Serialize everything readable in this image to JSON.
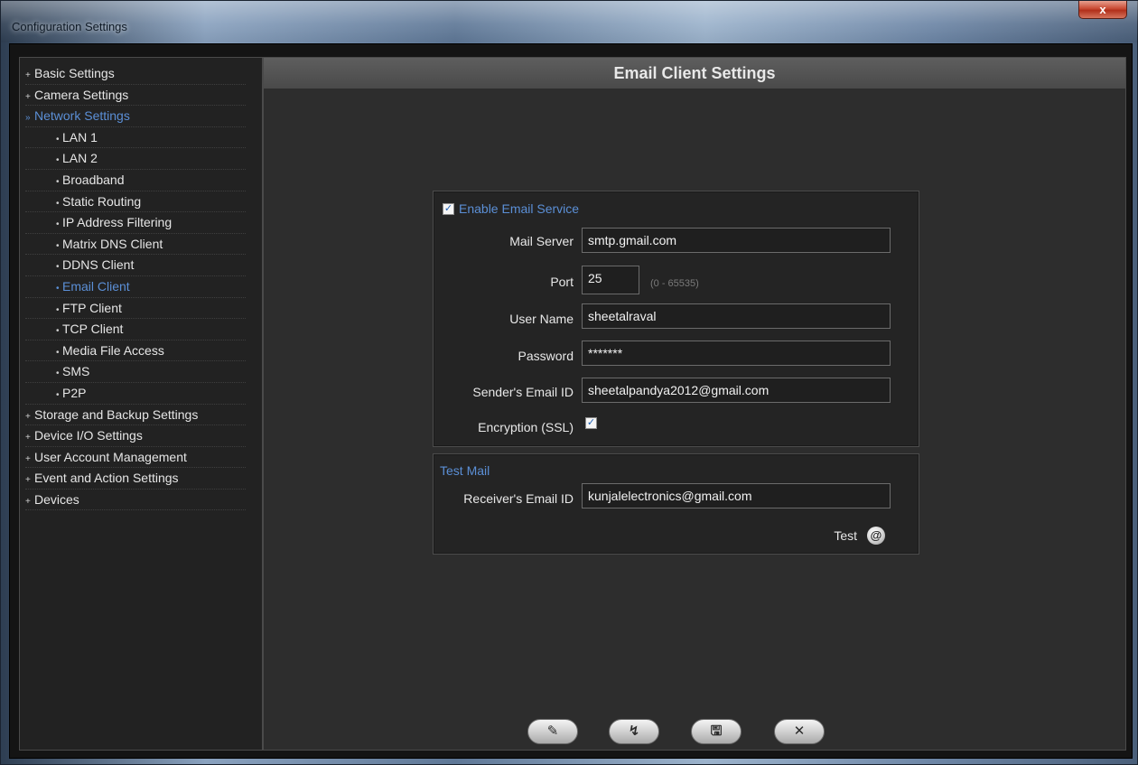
{
  "window": {
    "title": "Configuration Settings",
    "close_glyph": "x"
  },
  "sidebar": {
    "items": [
      {
        "label": "Basic Settings",
        "mark": "+",
        "level": 0,
        "active": false
      },
      {
        "label": "Camera Settings",
        "mark": "+",
        "level": 0,
        "active": false
      },
      {
        "label": "Network Settings",
        "mark": "»",
        "level": 0,
        "active": true
      },
      {
        "label": "LAN 1",
        "mark": "•",
        "level": 1,
        "active": false
      },
      {
        "label": "LAN 2",
        "mark": "•",
        "level": 1,
        "active": false
      },
      {
        "label": "Broadband",
        "mark": "•",
        "level": 1,
        "active": false
      },
      {
        "label": "Static Routing",
        "mark": "•",
        "level": 1,
        "active": false
      },
      {
        "label": "IP Address Filtering",
        "mark": "•",
        "level": 1,
        "active": false
      },
      {
        "label": "Matrix DNS Client",
        "mark": "•",
        "level": 1,
        "active": false
      },
      {
        "label": "DDNS Client",
        "mark": "•",
        "level": 1,
        "active": false
      },
      {
        "label": "Email Client",
        "mark": "•",
        "level": 1,
        "active": true
      },
      {
        "label": "FTP Client",
        "mark": "•",
        "level": 1,
        "active": false
      },
      {
        "label": "TCP Client",
        "mark": "•",
        "level": 1,
        "active": false
      },
      {
        "label": "Media File Access",
        "mark": "•",
        "level": 1,
        "active": false
      },
      {
        "label": "SMS",
        "mark": "•",
        "level": 1,
        "active": false
      },
      {
        "label": "P2P",
        "mark": "•",
        "level": 1,
        "active": false
      },
      {
        "label": "Storage and Backup Settings",
        "mark": "+",
        "level": 0,
        "active": false
      },
      {
        "label": "Device I/O Settings",
        "mark": "+",
        "level": 0,
        "active": false
      },
      {
        "label": "User Account Management",
        "mark": "+",
        "level": 0,
        "active": false
      },
      {
        "label": "Event and Action Settings",
        "mark": "+",
        "level": 0,
        "active": false
      },
      {
        "label": "Devices",
        "mark": "+",
        "level": 0,
        "active": false
      }
    ]
  },
  "main": {
    "header": "Email Client Settings",
    "enable": {
      "label": "Enable Email Service",
      "checked": true
    },
    "fields": {
      "mail_server": {
        "label": "Mail Server",
        "value": "smtp.gmail.com"
      },
      "port": {
        "label": "Port",
        "value": "25",
        "hint": "(0 - 65535)"
      },
      "user_name": {
        "label": "User Name",
        "value": "sheetalraval"
      },
      "password": {
        "label": "Password",
        "value": "*******"
      },
      "sender": {
        "label": "Sender's Email ID",
        "value": "sheetalpandya2012@gmail.com"
      },
      "ssl": {
        "label": "Encryption (SSL)",
        "checked": true
      }
    },
    "test_mail": {
      "title": "Test Mail",
      "receiver_label": "Receiver's Email ID",
      "receiver_value": "kunjalelectronics@gmail.com",
      "test_label": "Test",
      "test_icon_glyph": "@"
    }
  },
  "buttons": {
    "apply": {
      "icon": "edit-check-icon",
      "glyph": "✎"
    },
    "refresh": {
      "icon": "refresh-icon",
      "glyph": "↯"
    },
    "save": {
      "icon": "save-icon",
      "glyph": "🖫"
    },
    "close": {
      "icon": "close-icon",
      "glyph": "✕"
    }
  },
  "colors": {
    "accent": "#5b8fd6",
    "panel": "#2d2d2d",
    "close_button": "#c94a33"
  }
}
